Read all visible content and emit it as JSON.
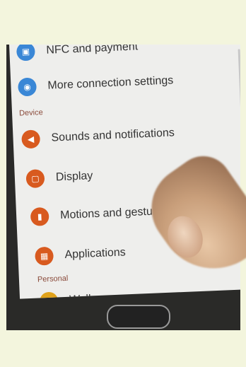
{
  "settings": {
    "items_connections": [
      {
        "label": "NFC and payment",
        "icon": "nfc-icon",
        "color": "#3a87d6"
      },
      {
        "label": "More connection settings",
        "icon": "wireless-icon",
        "color": "#3a87d6"
      }
    ],
    "section_device": "Device",
    "items_device": [
      {
        "label": "Sounds and notifications",
        "icon": "speaker-icon",
        "color": "#d85a1f"
      },
      {
        "label": "Display",
        "icon": "display-icon",
        "color": "#d85a1f"
      },
      {
        "label": "Motions and gestures",
        "icon": "hand-icon",
        "color": "#d85a1f"
      },
      {
        "label": "Applications",
        "icon": "apps-grid-icon",
        "color": "#d85a1f"
      }
    ],
    "section_personal": "Personal",
    "items_personal": [
      {
        "label": "Wallpaper",
        "icon": "wallpaper-icon",
        "color": "#e0a21a"
      }
    ]
  }
}
